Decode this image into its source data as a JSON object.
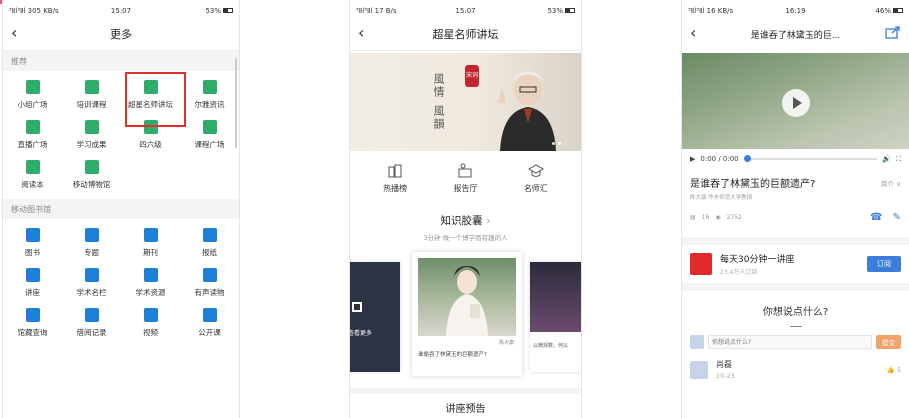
{
  "panel1": {
    "status": {
      "net": "³Ⅱl³Ⅱl 305 KB/s",
      "time": "15:07",
      "battery": "53%"
    },
    "nav": {
      "back": "‹",
      "title": "更多"
    },
    "section_recommend": "推荐",
    "recommend_items": [
      {
        "label": "小组广场",
        "icon": "group-icon",
        "color": "#2dac6a"
      },
      {
        "label": "培训课程",
        "icon": "training-icon",
        "color": "#2dac6a"
      },
      {
        "label": "超星名师讲坛",
        "icon": "lecture-hall-icon",
        "color": "#2dac6a"
      },
      {
        "label": "尔雅资讯",
        "icon": "news-icon",
        "color": "#2dac6a"
      },
      {
        "label": "直播广场",
        "icon": "live-icon",
        "color": "#2dac6a"
      },
      {
        "label": "学习成果",
        "icon": "achievement-icon",
        "color": "#2dac6a"
      },
      {
        "label": "四六级",
        "icon": "cet-icon",
        "color": "#2dac6a"
      },
      {
        "label": "课程广场",
        "icon": "course-square-icon",
        "color": "#2dac6a"
      },
      {
        "label": "阅读本",
        "icon": "reader-icon",
        "color": "#2dac6a"
      },
      {
        "label": "移动博物馆",
        "icon": "museum-icon",
        "color": "#2dac6a"
      }
    ],
    "section_library": "移动图书馆",
    "library_items": [
      {
        "label": "图书",
        "icon": "book-icon",
        "color": "#1e7fd8"
      },
      {
        "label": "专题",
        "icon": "topic-icon",
        "color": "#1e7fd8"
      },
      {
        "label": "期刊",
        "icon": "journal-icon",
        "color": "#1e7fd8"
      },
      {
        "label": "报纸",
        "icon": "newspaper-icon",
        "color": "#1e7fd8"
      },
      {
        "label": "讲座",
        "icon": "lecture-icon",
        "color": "#1e7fd8"
      },
      {
        "label": "学术名栏",
        "icon": "column-icon",
        "color": "#1e7fd8"
      },
      {
        "label": "学术资源",
        "icon": "academic-icon",
        "color": "#1e7fd8"
      },
      {
        "label": "有声读物",
        "icon": "audiobook-icon",
        "color": "#1e7fd8"
      },
      {
        "label": "馆藏查询",
        "icon": "catalog-search-icon",
        "color": "#1e7fd8"
      },
      {
        "label": "借阅记录",
        "icon": "borrow-record-icon",
        "color": "#1e7fd8"
      },
      {
        "label": "视频",
        "icon": "video-icon",
        "color": "#1e7fd8"
      },
      {
        "label": "公开课",
        "icon": "open-course-icon",
        "color": "#1e7fd8"
      }
    ]
  },
  "panel2": {
    "status": {
      "net": "³Ⅱl³Ⅱl 17 B/s",
      "time": "15:07",
      "battery": "53%"
    },
    "nav": {
      "back": "‹",
      "title": "超星名师讲坛"
    },
    "banner": {
      "calligraphy_top": "風情",
      "calligraphy_bottom": "風韻",
      "seal": "宋词"
    },
    "quick_links": [
      {
        "label": "热播榜",
        "icon": "hot-list-icon"
      },
      {
        "label": "报告厅",
        "icon": "report-hall-icon"
      },
      {
        "label": "名师汇",
        "icon": "teachers-icon"
      }
    ],
    "capsule": {
      "title": "知识胶囊",
      "arrow": "›",
      "subtitle": "3分钟·做一个博学而有趣的人"
    },
    "cards": {
      "left_caption": "查看更多",
      "main_author": "陈大康",
      "main_caption": "谁偷吞了林黛玉的巨额遗产?",
      "right_caption": "以微观数，何以"
    },
    "lecture_preview": "讲座预告"
  },
  "panel3": {
    "status": {
      "net": "³Ⅱl³Ⅱl 16 KB/s",
      "time": "16:19",
      "battery": "46%"
    },
    "nav": {
      "back": "‹",
      "title": "是谁吞了林黛玉的巨..."
    },
    "player": {
      "time": "0:00 / 0:00",
      "progress": 0
    },
    "video_title": "是谁吞了林黛玉的巨额遗产?",
    "intro_label": "简介 ∨",
    "author": "陈大康  华东师范大学教授",
    "stats": {
      "episodes": "16",
      "views": "2752"
    },
    "channel": {
      "name": "每天30分钟一讲座",
      "subs": "23.4万人订阅",
      "subscribe": "订阅"
    },
    "ask": "你想说点什么?",
    "comment_input": {
      "placeholder": "你想说点什么?",
      "submit": "提交"
    },
    "comment": {
      "name": "肖磊",
      "date": "10-23",
      "likes": "5"
    }
  }
}
